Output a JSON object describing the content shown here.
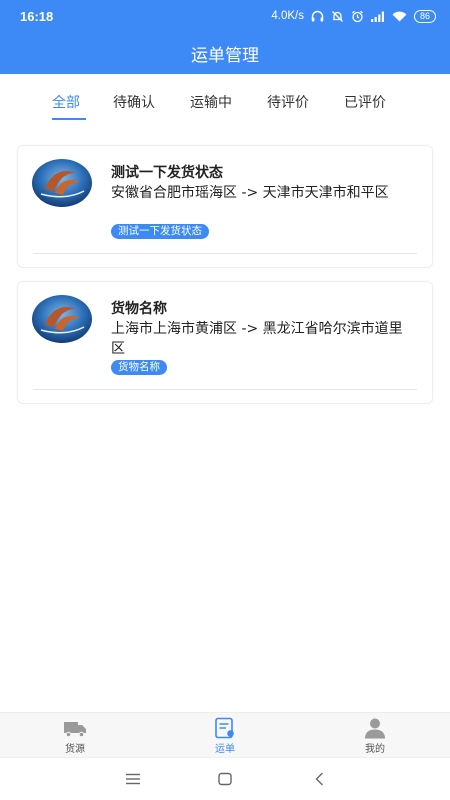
{
  "status_bar": {
    "time": "16:18",
    "net_speed": "4.0K/s",
    "battery": "86",
    "icons": [
      "headphones-icon",
      "mute-bell-icon",
      "alarm-icon",
      "signal-icon",
      "wifi-icon"
    ]
  },
  "header": {
    "title": "运单管理"
  },
  "tabs": [
    {
      "label": "全部",
      "active": true
    },
    {
      "label": "待确认",
      "active": false
    },
    {
      "label": "运输中",
      "active": false
    },
    {
      "label": "待评价",
      "active": false
    },
    {
      "label": "已评价",
      "active": false
    }
  ],
  "orders": [
    {
      "name": "测试一下发货状态",
      "route": "安徽省合肥市瑶海区 -> 天津市天津市和平区",
      "tag": "测试一下发货状态"
    },
    {
      "name": "货物名称",
      "route": "上海市上海市黄浦区 -> 黑龙江省哈尔滨市道里区",
      "tag": "货物名称"
    }
  ],
  "bottom_nav": [
    {
      "label": "货源",
      "icon": "truck-icon",
      "active": false
    },
    {
      "label": "运单",
      "icon": "waybill-icon",
      "active": true
    },
    {
      "label": "我的",
      "icon": "person-icon",
      "active": false
    }
  ],
  "colors": {
    "primary": "#3d8af7",
    "background": "#ffffff",
    "nav_background": "#f7f7f7"
  }
}
